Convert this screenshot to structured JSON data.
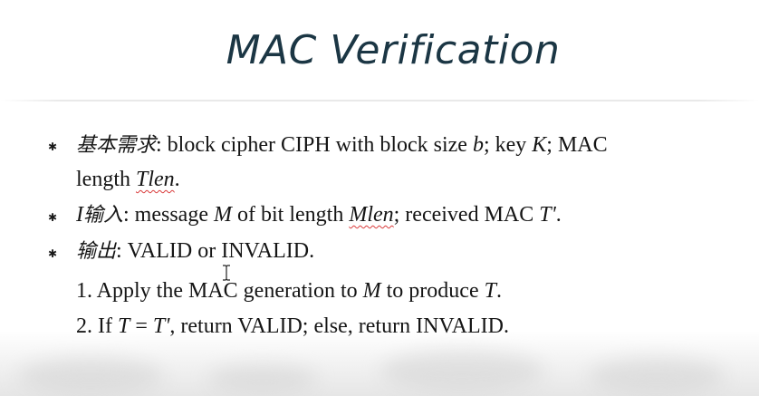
{
  "slide": {
    "title": "MAC Verification",
    "bullets": [
      {
        "label": "基本需求",
        "text_parts": [
          ": block cipher CIPH with block size ",
          "b",
          "; key ",
          "K",
          "; MAC"
        ],
        "continuation_parts": [
          "length ",
          "Tlen",
          "."
        ]
      },
      {
        "label_prefix": "I",
        "label": "输入",
        "text_parts": [
          ": message ",
          "M",
          " of bit length ",
          "Mlen",
          "; received MAC ",
          "T'",
          "."
        ]
      },
      {
        "label": "输出",
        "text_parts": [
          ": VALID or INVALID."
        ]
      }
    ],
    "steps": [
      {
        "text_parts": [
          "1. Apply the MAC generation to ",
          "M",
          " to produce ",
          "T",
          "."
        ]
      },
      {
        "text_parts": [
          "2. If ",
          "T",
          " = ",
          "T'",
          ", return VALID; else, return INVALID."
        ]
      }
    ]
  },
  "decor": {
    "title_color": "#1b3644",
    "text_color": "#151515",
    "spellcheck_color": "#d93a3a",
    "bullet_glyph": "✱",
    "cursor_icon": "i-beam-cursor-icon"
  }
}
